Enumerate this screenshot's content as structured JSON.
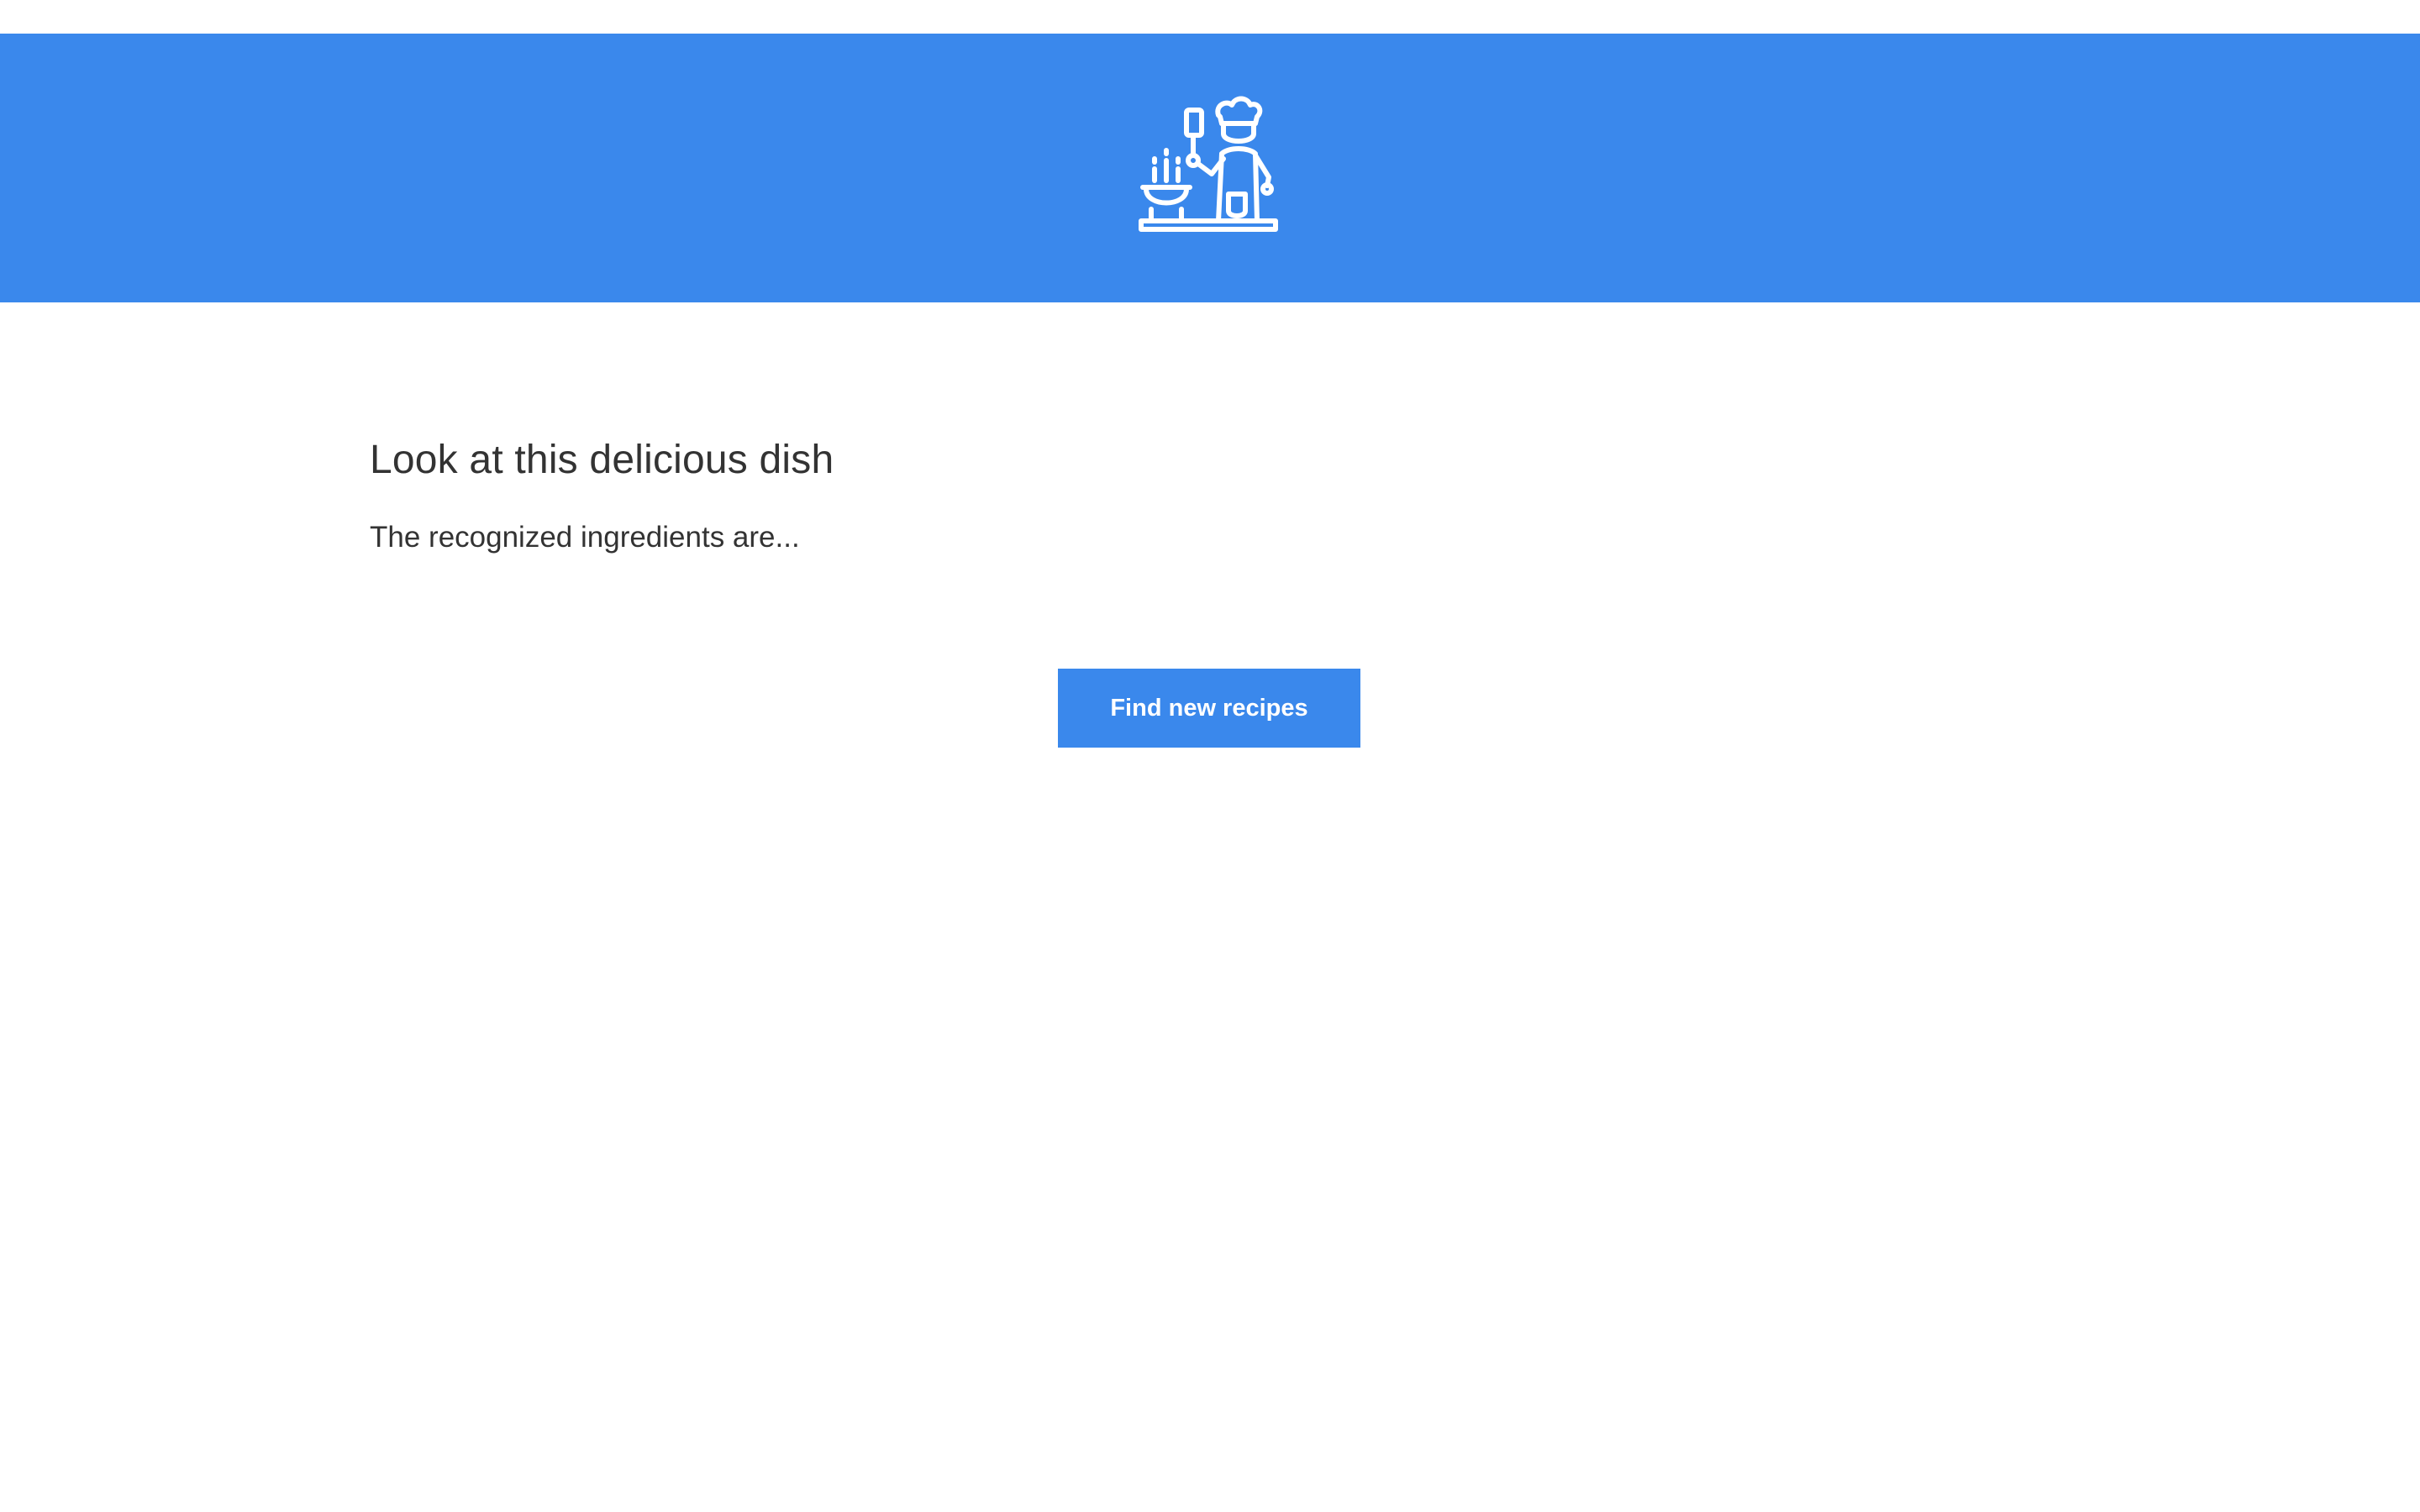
{
  "header": {
    "logo_icon": "chef-cooking-icon",
    "background_color": "#3a88ec"
  },
  "main": {
    "title": "Look at this delicious dish",
    "subtitle": "The recognized ingredients are..."
  },
  "actions": {
    "find_recipes_label": "Find new recipes"
  },
  "colors": {
    "accent": "#3a88ec",
    "text": "#333333"
  }
}
